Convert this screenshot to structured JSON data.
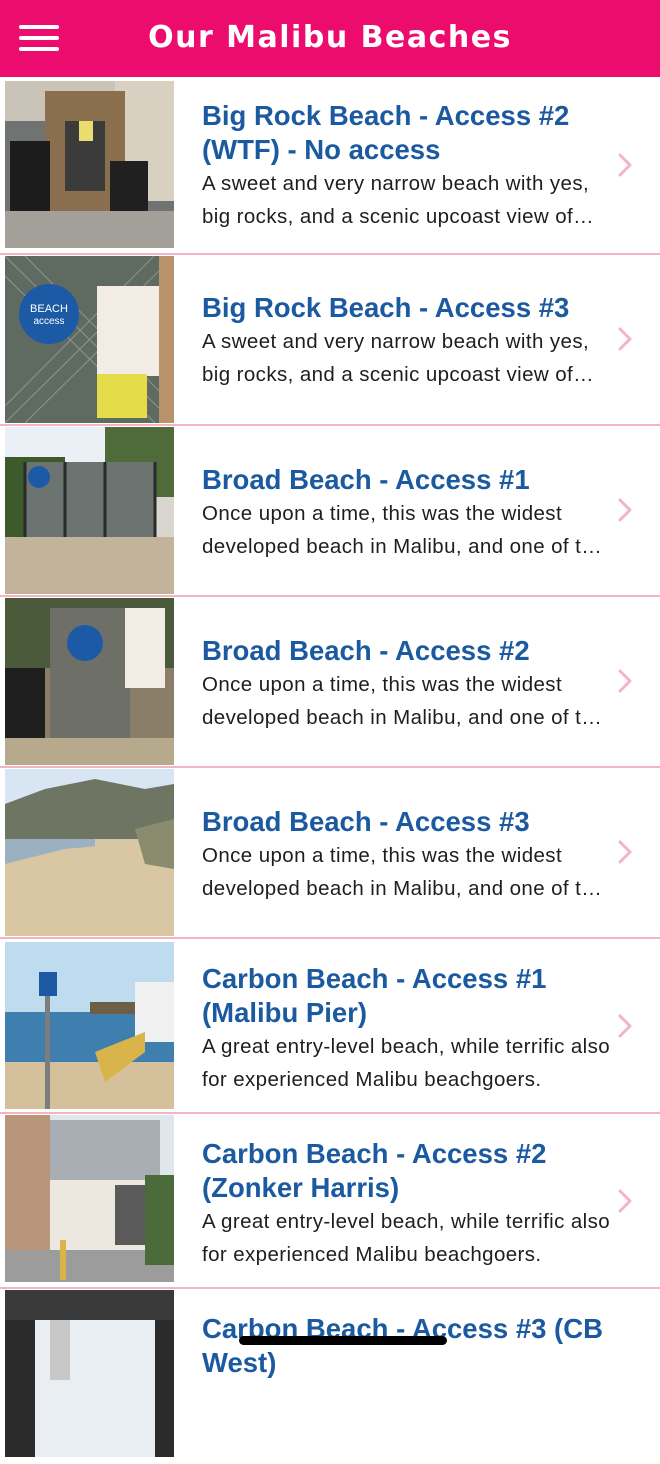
{
  "header": {
    "title": "Our Malibu Beaches",
    "menu_icon": "hamburger-menu-icon",
    "background": "#ec0c6d"
  },
  "colors": {
    "title": "#1b5aa0",
    "description": "#1e1e1e",
    "separator": "#f4b4c2",
    "chevron": "#f4b4c2"
  },
  "beaches": [
    {
      "title": "Big Rock Beach - Access #2 (WTF) - No access",
      "description": "A sweet and very narrow beach with yes, big rocks, and a scenic upcoast view of Malibu."
    },
    {
      "title": "Big Rock Beach - Access #3",
      "description": "A sweet and very narrow beach with yes, big rocks, and a scenic upcoast view of Malibu."
    },
    {
      "title": "Broad Beach - Access #1",
      "description": "Once upon a time, this was the widest developed beach in Malibu, and one of the best."
    },
    {
      "title": "Broad Beach - Access #2",
      "description": "Once upon a time, this was the widest developed beach in Malibu, and one of the best."
    },
    {
      "title": "Broad Beach - Access #3",
      "description": "Once upon a time, this was the widest developed beach in Malibu, and one of the best."
    },
    {
      "title": "Carbon Beach - Access #1 (Malibu Pier)",
      "description": "A great entry-level beach, while terrific also for experienced Malibu beachgoers."
    },
    {
      "title": "Carbon Beach - Access #2 (Zonker Harris)",
      "description": "A great entry-level beach, while terrific also for experienced Malibu beachgoers."
    },
    {
      "title": "Carbon Beach - Access #3 (CB West)",
      "description": ""
    }
  ]
}
